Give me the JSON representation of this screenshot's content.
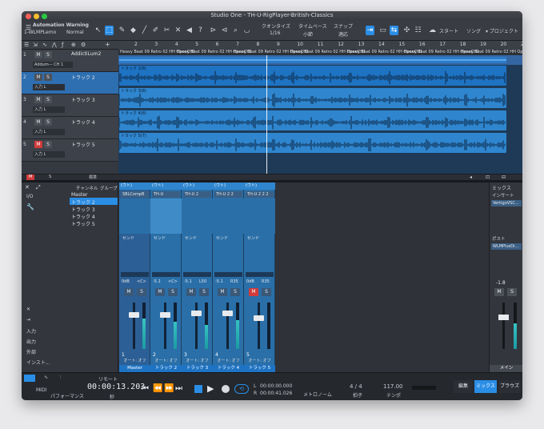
{
  "window": {
    "title": "Studio One - TH-U-RigPlayer-British-Classics"
  },
  "toolbar": {
    "warning_title": "Automation Warning",
    "plugin_name": "1-WLMPLemo",
    "mode": "Normal",
    "quantize_label": "クオンタイズ",
    "quantize_value": "1/16",
    "timebase_label": "タイムベース",
    "timebase_value": "小節",
    "snap_label": "スナップ",
    "snap_value": "適応",
    "start_label": "スタート",
    "song_label": "ソング",
    "project_label": "▾ プロジェクト"
  },
  "ruler": {
    "marks": [
      "2",
      "3",
      "4",
      "5",
      "6",
      "7",
      "8",
      "9",
      "10",
      "11",
      "12",
      "13",
      "14",
      "15",
      "16",
      "17",
      "18",
      "19",
      "20",
      "21"
    ]
  },
  "chords": [
    "Heavy Beat 09 Retro 02 HH OpenCH1",
    "Heavy Beat 09 Retro 02 HH OpenCH1",
    "Heavy Beat 09 Retro 02 HH OpenCH1",
    "Heavy Beat 09 Retro 02 HH OpenCH1",
    "Heavy Beat 09 Retro 02 HH OpenCH1",
    "Heavy Beat 09 Retro 02 HH OpenCH1",
    "Heavy Beat 09 Retro 02 HH OpenCH1"
  ],
  "tracks": [
    {
      "num": "1",
      "name": "AddictiLum2",
      "input": "Addum— CH 1",
      "mute": false
    },
    {
      "num": "2",
      "name": "トラック 2",
      "input": "入力 L",
      "mute": false
    },
    {
      "num": "3",
      "name": "トラック 3",
      "input": "入力 L",
      "mute": false
    },
    {
      "num": "4",
      "name": "トラック 4",
      "input": "入力 L",
      "mute": false
    },
    {
      "num": "5",
      "name": "トラック 5",
      "input": "入力 L",
      "mute": true
    }
  ],
  "clips": [
    {
      "label": "トラック 2(8)"
    },
    {
      "label": "トラック 3(8)"
    },
    {
      "label": "トラック 4(8)"
    },
    {
      "label": "トラック 5(7)"
    }
  ],
  "arrange_footer": {
    "zoom_label": "標準"
  },
  "mixer": {
    "channel_header": "チャンネル",
    "group_header": "グループ",
    "channels": [
      "Master",
      "トラック 2",
      "トラック 3",
      "トラック 4",
      "トラック 5"
    ],
    "side_labels": {
      "io": "I/O",
      "input": "入力",
      "output": "出力",
      "external": "外部",
      "instrument": "インスト..."
    },
    "strips": [
      {
        "insert": "SBLCompB",
        "send": "センド",
        "vol": "0dB",
        "pan": "<C>",
        "num": "1",
        "auto": "オート: オフ",
        "name": "Master",
        "mute": false
      },
      {
        "insert": "TH-U",
        "send": "センド",
        "vol": "-5.1",
        "pan": "<C>",
        "num": "2",
        "auto": "オート: オフ",
        "name": "トラック 2",
        "mute": false
      },
      {
        "insert": "TH-U 2",
        "send": "センド",
        "vol": "-5.1",
        "pan": "L50",
        "num": "3",
        "auto": "オート: オフ",
        "name": "トラック 3",
        "mute": false
      },
      {
        "insert": "TH-U 2 2",
        "send": "センド",
        "vol": "-5.1",
        "pan": "R35",
        "num": "4",
        "auto": "オート: オフ",
        "name": "トラック 4",
        "mute": false
      },
      {
        "insert": "TH-U 2 2 2",
        "send": "センド",
        "vol": "0dB",
        "pan": "R35",
        "num": "5",
        "auto": "オート: オフ",
        "name": "トラック 5",
        "mute": true
      }
    ],
    "io_out": "(ウト)",
    "mute_label": "M",
    "solo_label": "S"
  },
  "main_pane": {
    "mix_label": "ミックス",
    "insert_label": "インサート",
    "insert_item": "VertigoVSC...",
    "post_label": "ポスト",
    "post_item": "WLMPlusDi...",
    "vol": "-1.8",
    "name": "メイン"
  },
  "transport": {
    "midi_label": "MIDI",
    "perf_label": "パフォーマンス",
    "time_main": "00:00:13.203",
    "time_sub": "秒",
    "loop_l": "00:00:00.000",
    "loop_r": "00:00:41.026",
    "metronome_label": "メトロノーム",
    "signature": "4 / 4",
    "signature_label": "拍子",
    "tempo": "117.00",
    "tempo_label": "テンポ",
    "edit_label": "編集",
    "mix_label": "ミックス",
    "browse_label": "ブラウズ",
    "remote_label": "リモート"
  },
  "colors": {
    "accent": "#2a8ee6",
    "clip": "#2f86cf",
    "mute": "#d13b3b"
  }
}
